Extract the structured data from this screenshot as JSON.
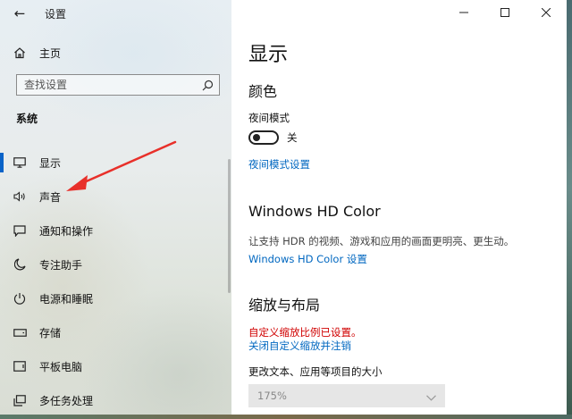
{
  "window": {
    "title": "设置"
  },
  "sidebar": {
    "home_label": "主页",
    "search_placeholder": "查找设置",
    "section_label": "系统",
    "items": [
      {
        "label": "显示",
        "icon": "monitor-icon",
        "active": true
      },
      {
        "label": "声音",
        "icon": "speaker-icon"
      },
      {
        "label": "通知和操作",
        "icon": "notification-icon"
      },
      {
        "label": "专注助手",
        "icon": "moon-icon"
      },
      {
        "label": "电源和睡眠",
        "icon": "power-icon"
      },
      {
        "label": "存储",
        "icon": "storage-icon"
      },
      {
        "label": "平板电脑",
        "icon": "tablet-icon"
      },
      {
        "label": "多任务处理",
        "icon": "multitask-icon"
      }
    ]
  },
  "content": {
    "page_title": "显示",
    "color_heading": "颜色",
    "night_mode_label": "夜间模式",
    "night_mode_state": "关",
    "night_mode_settings_link": "夜间模式设置",
    "hdr_heading": "Windows HD Color",
    "hdr_description": "让支持 HDR 的视频、游戏和应用的画面更明亮、更生动。",
    "hdr_link": "Windows HD Color 设置",
    "scale_heading": "缩放与布局",
    "scale_warning": "自定义缩放比例已设置。",
    "scale_disable_link": "关闭自定义缩放并注销",
    "text_size_label": "更改文本、应用等项目的大小",
    "text_size_value": "175%"
  },
  "colors": {
    "accent": "#0067c0",
    "active_indicator": "#0a63c8",
    "warning": "#d00000",
    "annotation_arrow": "#e8302a"
  }
}
